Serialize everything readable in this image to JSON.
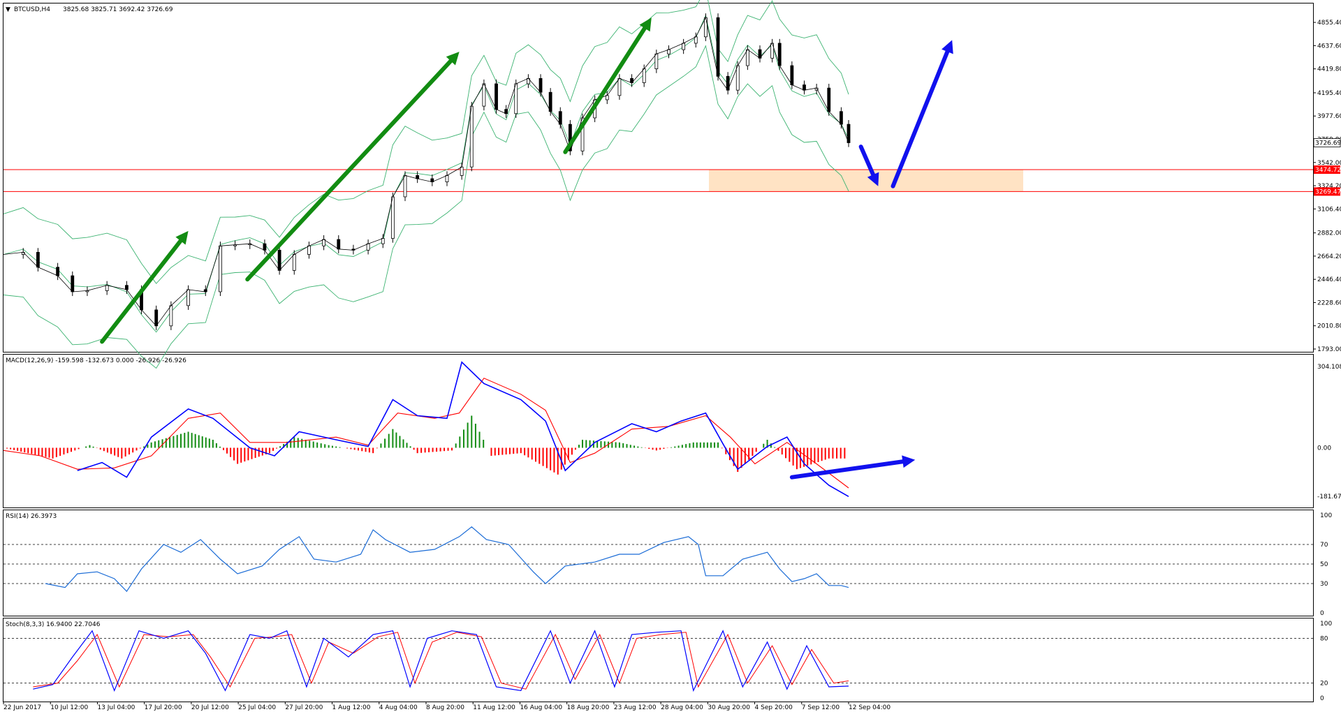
{
  "chart_data": {
    "type": "line",
    "symbol": "BTCUSD,H4",
    "ohlc_readout": "3825.68 3825.71 3692.42 3726.69",
    "price_panel": {
      "ylim": [
        1793.0,
        5000.0
      ],
      "y_ticks": [
        "4855.40",
        "4637.60",
        "4419.80",
        "4195.40",
        "3977.60",
        "3759.80",
        "3542.00",
        "3324.20",
        "3106.40",
        "2882.00",
        "2664.20",
        "2446.40",
        "2228.60",
        "2010.80",
        "1793.00"
      ],
      "current_price": "3726.69",
      "support_levels": [
        {
          "label": "3474.72",
          "value": 3474.72,
          "color": "#ff0000"
        },
        {
          "label": "3269.47",
          "value": 3269.47,
          "color": "#ff0000"
        }
      ],
      "zone": {
        "from": 3269.47,
        "to": 3474.72,
        "color": "#ffe3c4"
      },
      "close_path": [
        [
          0,
          2680
        ],
        [
          8,
          2700
        ],
        [
          14,
          2560
        ],
        [
          22,
          2480
        ],
        [
          28,
          2330
        ],
        [
          34,
          2340
        ],
        [
          42,
          2390
        ],
        [
          50,
          2350
        ],
        [
          56,
          2160
        ],
        [
          62,
          2010
        ],
        [
          68,
          2200
        ],
        [
          75,
          2350
        ],
        [
          82,
          2330
        ],
        [
          88,
          2760
        ],
        [
          94,
          2770
        ],
        [
          100,
          2780
        ],
        [
          106,
          2720
        ],
        [
          112,
          2530
        ],
        [
          118,
          2680
        ],
        [
          124,
          2760
        ],
        [
          130,
          2820
        ],
        [
          136,
          2730
        ],
        [
          142,
          2720
        ],
        [
          148,
          2780
        ],
        [
          154,
          2830
        ],
        [
          158,
          3220
        ],
        [
          163,
          3420
        ],
        [
          168,
          3390
        ],
        [
          174,
          3360
        ],
        [
          180,
          3420
        ],
        [
          186,
          3500
        ],
        [
          190,
          4070
        ],
        [
          195,
          4280
        ],
        [
          200,
          4040
        ],
        [
          204,
          4000
        ],
        [
          208,
          4280
        ],
        [
          213,
          4330
        ],
        [
          218,
          4200
        ],
        [
          222,
          4020
        ],
        [
          226,
          3900
        ],
        [
          230,
          3650
        ],
        [
          235,
          3960
        ],
        [
          240,
          4130
        ],
        [
          245,
          4170
        ],
        [
          250,
          4330
        ],
        [
          255,
          4290
        ],
        [
          260,
          4420
        ],
        [
          265,
          4560
        ],
        [
          270,
          4600
        ],
        [
          276,
          4660
        ],
        [
          281,
          4720
        ],
        [
          285,
          4900
        ],
        [
          290,
          4350
        ],
        [
          294,
          4220
        ],
        [
          298,
          4450
        ],
        [
          302,
          4600
        ],
        [
          307,
          4520
        ],
        [
          312,
          4660
        ],
        [
          315,
          4450
        ],
        [
          320,
          4270
        ],
        [
          325,
          4220
        ],
        [
          330,
          4240
        ],
        [
          335,
          4020
        ],
        [
          340,
          3900
        ],
        [
          343,
          3727
        ]
      ],
      "arrows": [
        {
          "from": [
            40,
            1862
          ],
          "to": [
            75,
            2900
          ],
          "color": "#128c12"
        },
        {
          "from": [
            99,
            2446
          ],
          "to": [
            185,
            4580
          ],
          "color": "#128c12"
        },
        {
          "from": [
            228,
            3640
          ],
          "to": [
            263,
            4900
          ],
          "color": "#128c12"
        },
        {
          "from": [
            348,
            3690
          ],
          "to": [
            355,
            3320
          ],
          "color": "#1111ee"
        },
        {
          "from": [
            361,
            3320
          ],
          "to": [
            385,
            4690
          ],
          "color": "#1111ee"
        }
      ]
    },
    "macd_panel": {
      "label": "MACD(12,26,9) -159.598 -132.673 0.000 -26.926 -26.926",
      "ylim": [
        -210,
        330
      ],
      "y_ticks": [
        "304.108",
        "0.00",
        "-181.679"
      ],
      "histogram_color_up": "#128c12",
      "histogram_color_down": "#ff0000",
      "macd_color": "#0000ff",
      "signal_color": "#ff0000",
      "macd_path": [
        [
          30,
          -85
        ],
        [
          40,
          -55
        ],
        [
          50,
          -110
        ],
        [
          60,
          40
        ],
        [
          75,
          145
        ],
        [
          85,
          110
        ],
        [
          100,
          0
        ],
        [
          110,
          -30
        ],
        [
          120,
          60
        ],
        [
          135,
          30
        ],
        [
          148,
          5
        ],
        [
          158,
          180
        ],
        [
          168,
          120
        ],
        [
          180,
          110
        ],
        [
          186,
          320
        ],
        [
          195,
          240
        ],
        [
          210,
          180
        ],
        [
          220,
          100
        ],
        [
          228,
          -85
        ],
        [
          240,
          20
        ],
        [
          255,
          90
        ],
        [
          265,
          60
        ],
        [
          275,
          100
        ],
        [
          285,
          130
        ],
        [
          292,
          15
        ],
        [
          298,
          -80
        ],
        [
          310,
          5
        ],
        [
          318,
          40
        ],
        [
          325,
          -60
        ],
        [
          335,
          -140
        ],
        [
          343,
          -182
        ]
      ],
      "signal_path": [
        [
          0,
          -10
        ],
        [
          15,
          -30
        ],
        [
          30,
          -80
        ],
        [
          45,
          -75
        ],
        [
          60,
          -30
        ],
        [
          75,
          110
        ],
        [
          88,
          130
        ],
        [
          100,
          20
        ],
        [
          115,
          20
        ],
        [
          135,
          40
        ],
        [
          148,
          10
        ],
        [
          160,
          130
        ],
        [
          175,
          110
        ],
        [
          185,
          130
        ],
        [
          195,
          260
        ],
        [
          210,
          200
        ],
        [
          220,
          140
        ],
        [
          230,
          -55
        ],
        [
          240,
          -20
        ],
        [
          255,
          70
        ],
        [
          270,
          80
        ],
        [
          285,
          120
        ],
        [
          295,
          40
        ],
        [
          305,
          -60
        ],
        [
          318,
          20
        ],
        [
          330,
          -60
        ],
        [
          343,
          -150
        ]
      ],
      "hist_path": [
        [
          0,
          0
        ],
        [
          10,
          -20
        ],
        [
          20,
          -40
        ],
        [
          35,
          10
        ],
        [
          48,
          -40
        ],
        [
          60,
          20
        ],
        [
          75,
          60
        ],
        [
          85,
          30
        ],
        [
          95,
          -60
        ],
        [
          108,
          -20
        ],
        [
          118,
          40
        ],
        [
          132,
          10
        ],
        [
          150,
          -20
        ],
        [
          158,
          70
        ],
        [
          168,
          -20
        ],
        [
          182,
          -10
        ],
        [
          190,
          120
        ],
        [
          198,
          -30
        ],
        [
          210,
          -20
        ],
        [
          225,
          -100
        ],
        [
          235,
          30
        ],
        [
          250,
          20
        ],
        [
          265,
          -10
        ],
        [
          280,
          20
        ],
        [
          290,
          20
        ],
        [
          298,
          -90
        ],
        [
          310,
          30
        ],
        [
          322,
          -80
        ],
        [
          335,
          -40
        ],
        [
          343,
          -40
        ]
      ],
      "arrow": {
        "from": [
          320,
          -110
        ],
        "to": [
          370,
          -45
        ],
        "color": "#1111ee"
      }
    },
    "rsi_panel": {
      "label": "RSI(14) 26.3973",
      "ylim": [
        0,
        100
      ],
      "y_ticks": [
        "100",
        "70",
        "50",
        "30",
        "0"
      ],
      "levels": [
        70,
        50,
        30
      ],
      "line_color": "#1a6bd6",
      "rsi_path": [
        [
          17,
          30
        ],
        [
          25,
          26
        ],
        [
          30,
          40
        ],
        [
          38,
          42
        ],
        [
          45,
          35
        ],
        [
          50,
          22
        ],
        [
          56,
          45
        ],
        [
          65,
          70
        ],
        [
          72,
          62
        ],
        [
          80,
          75
        ],
        [
          88,
          55
        ],
        [
          95,
          40
        ],
        [
          105,
          48
        ],
        [
          112,
          65
        ],
        [
          120,
          78
        ],
        [
          126,
          55
        ],
        [
          135,
          52
        ],
        [
          145,
          60
        ],
        [
          150,
          85
        ],
        [
          155,
          75
        ],
        [
          165,
          62
        ],
        [
          175,
          65
        ],
        [
          185,
          78
        ],
        [
          190,
          88
        ],
        [
          196,
          75
        ],
        [
          205,
          70
        ],
        [
          215,
          42
        ],
        [
          220,
          30
        ],
        [
          228,
          48
        ],
        [
          240,
          52
        ],
        [
          250,
          60
        ],
        [
          258,
          60
        ],
        [
          268,
          72
        ],
        [
          278,
          78
        ],
        [
          282,
          70
        ],
        [
          285,
          38
        ],
        [
          292,
          38
        ],
        [
          300,
          55
        ],
        [
          310,
          62
        ],
        [
          315,
          45
        ],
        [
          320,
          32
        ],
        [
          325,
          35
        ],
        [
          330,
          40
        ],
        [
          335,
          28
        ],
        [
          340,
          28
        ],
        [
          343,
          26
        ]
      ]
    },
    "stoch_panel": {
      "label": "Stoch(8,3,3) 16.9400 22.7046",
      "ylim": [
        0,
        100
      ],
      "y_ticks": [
        "100",
        "80",
        "20",
        "0"
      ],
      "levels": [
        80,
        20
      ],
      "main_color": "#0000ff",
      "signal_color": "#ff0000",
      "main_path": [
        [
          12,
          12
        ],
        [
          20,
          18
        ],
        [
          28,
          55
        ],
        [
          36,
          90
        ],
        [
          45,
          10
        ],
        [
          55,
          90
        ],
        [
          65,
          80
        ],
        [
          75,
          90
        ],
        [
          82,
          60
        ],
        [
          90,
          10
        ],
        [
          100,
          85
        ],
        [
          108,
          80
        ],
        [
          115,
          90
        ],
        [
          123,
          15
        ],
        [
          130,
          80
        ],
        [
          140,
          55
        ],
        [
          150,
          85
        ],
        [
          158,
          90
        ],
        [
          165,
          15
        ],
        [
          172,
          80
        ],
        [
          182,
          90
        ],
        [
          192,
          85
        ],
        [
          200,
          15
        ],
        [
          210,
          10
        ],
        [
          222,
          90
        ],
        [
          230,
          20
        ],
        [
          240,
          90
        ],
        [
          248,
          15
        ],
        [
          255,
          85
        ],
        [
          265,
          88
        ],
        [
          275,
          90
        ],
        [
          280,
          10
        ],
        [
          292,
          90
        ],
        [
          300,
          15
        ],
        [
          310,
          75
        ],
        [
          318,
          12
        ],
        [
          326,
          70
        ],
        [
          335,
          15
        ],
        [
          343,
          16
        ]
      ],
      "signal_path": [
        [
          12,
          15
        ],
        [
          22,
          20
        ],
        [
          30,
          50
        ],
        [
          38,
          85
        ],
        [
          47,
          15
        ],
        [
          57,
          85
        ],
        [
          67,
          82
        ],
        [
          77,
          85
        ],
        [
          84,
          55
        ],
        [
          92,
          15
        ],
        [
          102,
          80
        ],
        [
          110,
          82
        ],
        [
          117,
          85
        ],
        [
          125,
          20
        ],
        [
          132,
          75
        ],
        [
          142,
          60
        ],
        [
          152,
          82
        ],
        [
          160,
          88
        ],
        [
          167,
          20
        ],
        [
          174,
          75
        ],
        [
          184,
          88
        ],
        [
          194,
          82
        ],
        [
          202,
          20
        ],
        [
          212,
          12
        ],
        [
          224,
          85
        ],
        [
          232,
          25
        ],
        [
          242,
          85
        ],
        [
          250,
          20
        ],
        [
          257,
          80
        ],
        [
          267,
          85
        ],
        [
          277,
          88
        ],
        [
          282,
          15
        ],
        [
          294,
          85
        ],
        [
          302,
          20
        ],
        [
          312,
          70
        ],
        [
          320,
          18
        ],
        [
          328,
          65
        ],
        [
          337,
          20
        ],
        [
          343,
          23
        ]
      ]
    },
    "x_ticks": [
      "22 Jun 2017",
      "10 Jul 12:00",
      "13 Jul 04:00",
      "17 Jul 20:00",
      "20 Jul 12:00",
      "25 Jul 04:00",
      "27 Jul 20:00",
      "1 Aug 12:00",
      "4 Aug 04:00",
      "8 Aug 20:00",
      "11 Aug 12:00",
      "16 Aug 04:00",
      "18 Aug 20:00",
      "23 Aug 12:00",
      "28 Aug 04:00",
      "30 Aug 20:00",
      "4 Sep 20:00",
      "7 Sep 12:00",
      "12 Sep 04:00"
    ]
  }
}
